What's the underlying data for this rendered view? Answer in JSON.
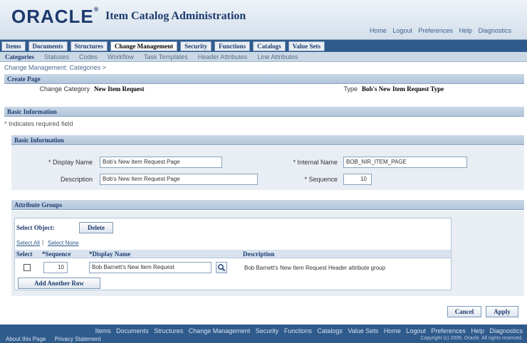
{
  "header": {
    "logo": "ORACLE",
    "logo_mark": "®",
    "app_title": "Item Catalog Administration",
    "global_links": [
      "Home",
      "Logout",
      "Preferences",
      "Help",
      "Diagnostics"
    ]
  },
  "tabs": [
    {
      "label": "Items",
      "active": false
    },
    {
      "label": "Documents",
      "active": false
    },
    {
      "label": "Structures",
      "active": false
    },
    {
      "label": "Change Management",
      "active": true
    },
    {
      "label": "Security",
      "active": false
    },
    {
      "label": "Functions",
      "active": false
    },
    {
      "label": "Catalogs",
      "active": false
    },
    {
      "label": "Value Sets",
      "active": false
    }
  ],
  "subtabs": [
    {
      "label": "Categories",
      "active": true
    },
    {
      "label": "Statuses",
      "active": false
    },
    {
      "label": "Codes",
      "active": false
    },
    {
      "label": "Workflow",
      "active": false
    },
    {
      "label": "Task Templates",
      "active": false
    },
    {
      "label": "Header Attributes",
      "active": false
    },
    {
      "label": "Line Attributes",
      "active": false
    }
  ],
  "breadcrumb": "Change Management: Categories >",
  "create_page": {
    "title": "Create Page",
    "change_category_label": "Change Category",
    "change_category_value": "New Item Request",
    "type_label": "Type",
    "type_value": "Bob's New Item Request Type"
  },
  "basic_info_header": "Basic Information",
  "required_note": "* Indicates required field",
  "basic_info": {
    "title": "Basic Information",
    "display_name_label": "* Display Name",
    "display_name_value": "Bob's New Item Request Page",
    "description_label": "Description",
    "description_value": "Bob's New Item Request Page",
    "internal_name_label": "* Internal Name",
    "internal_name_value": "BOB_NIR_ITEM_PAGE",
    "sequence_label": "* Sequence",
    "sequence_value": "10"
  },
  "attribute_groups": {
    "title": "Attribute Groups",
    "select_object_label": "Select Object:",
    "delete_button": "Delete",
    "select_all": "Select All",
    "select_none": "Select None",
    "columns": [
      "Select",
      "*Sequence",
      "*Display Name",
      "Description"
    ],
    "rows": [
      {
        "sequence": "10",
        "display_name": "Bob Barnett's New Item Request",
        "description": "Bob Barnett's New Item Request Header attribute group"
      }
    ],
    "add_row_button": "Add Another Row"
  },
  "actions": {
    "cancel": "Cancel",
    "apply": "Apply"
  },
  "footer": {
    "links": [
      "Items",
      "Documents",
      "Structures",
      "Change Management",
      "Security",
      "Functions",
      "Catalogs",
      "Value Sets",
      "Home",
      "Logout",
      "Preferences",
      "Help",
      "Diagnostics"
    ],
    "bottom_links": [
      "About this Page",
      "Privacy Statement"
    ],
    "copyright": "Copyright (c) 2006, Oracle. All rights reserved."
  },
  "colors": {
    "brand": "#1c3a6e",
    "tabbar": "#2f5a8c",
    "panel": "#e9eef4"
  }
}
